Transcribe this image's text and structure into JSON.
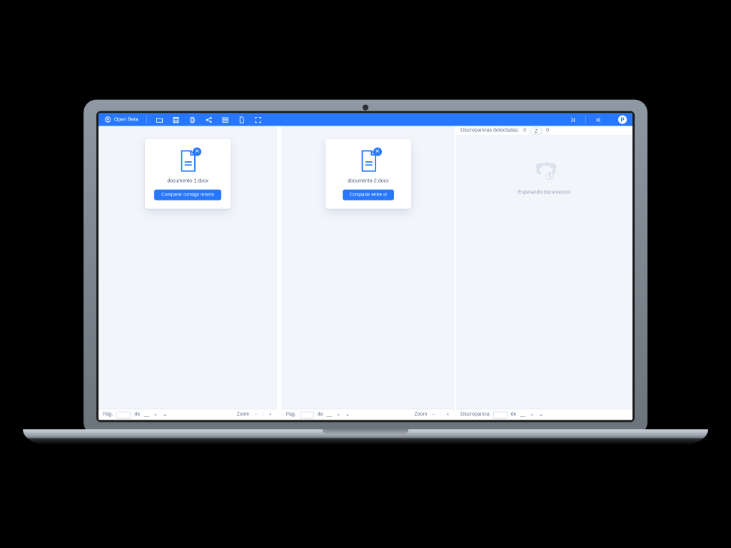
{
  "app": {
    "name": "Open Beta"
  },
  "account": {
    "badge_letter": "P"
  },
  "toolbar": {
    "icons": {
      "open": "folder-open-icon",
      "save": "save-icon",
      "print": "print-icon",
      "share": "share-icon",
      "layout": "layout-icon",
      "doc": "doc-icon",
      "fullscreen": "fullscreen-icon"
    }
  },
  "center_nav": {
    "to_end": ">|",
    "to_start": "|<"
  },
  "panels": {
    "left": {
      "doc_name": "documento-1.docx",
      "action_label": "Comparar consigo mismo",
      "footer": {
        "page_label": "Pág.",
        "of_label": "de",
        "total": "__",
        "zoom_label": "Zoom"
      }
    },
    "mid": {
      "doc_name": "documento-2.docx",
      "action_label": "Comparar entre sí",
      "footer": {
        "page_label": "Pág.",
        "of_label": "de",
        "total": "__",
        "zoom_label": "Zoom"
      }
    },
    "right": {
      "header": {
        "discrepancies_label": "Discrepancias detectadas:",
        "discrepancies_count": "0",
        "swap_label": "",
        "swap_count": "0"
      },
      "waiting_text": "Esperando documentos",
      "footer": {
        "disc_label": "Discrepancia",
        "of_label": "de",
        "total": "__"
      }
    }
  }
}
